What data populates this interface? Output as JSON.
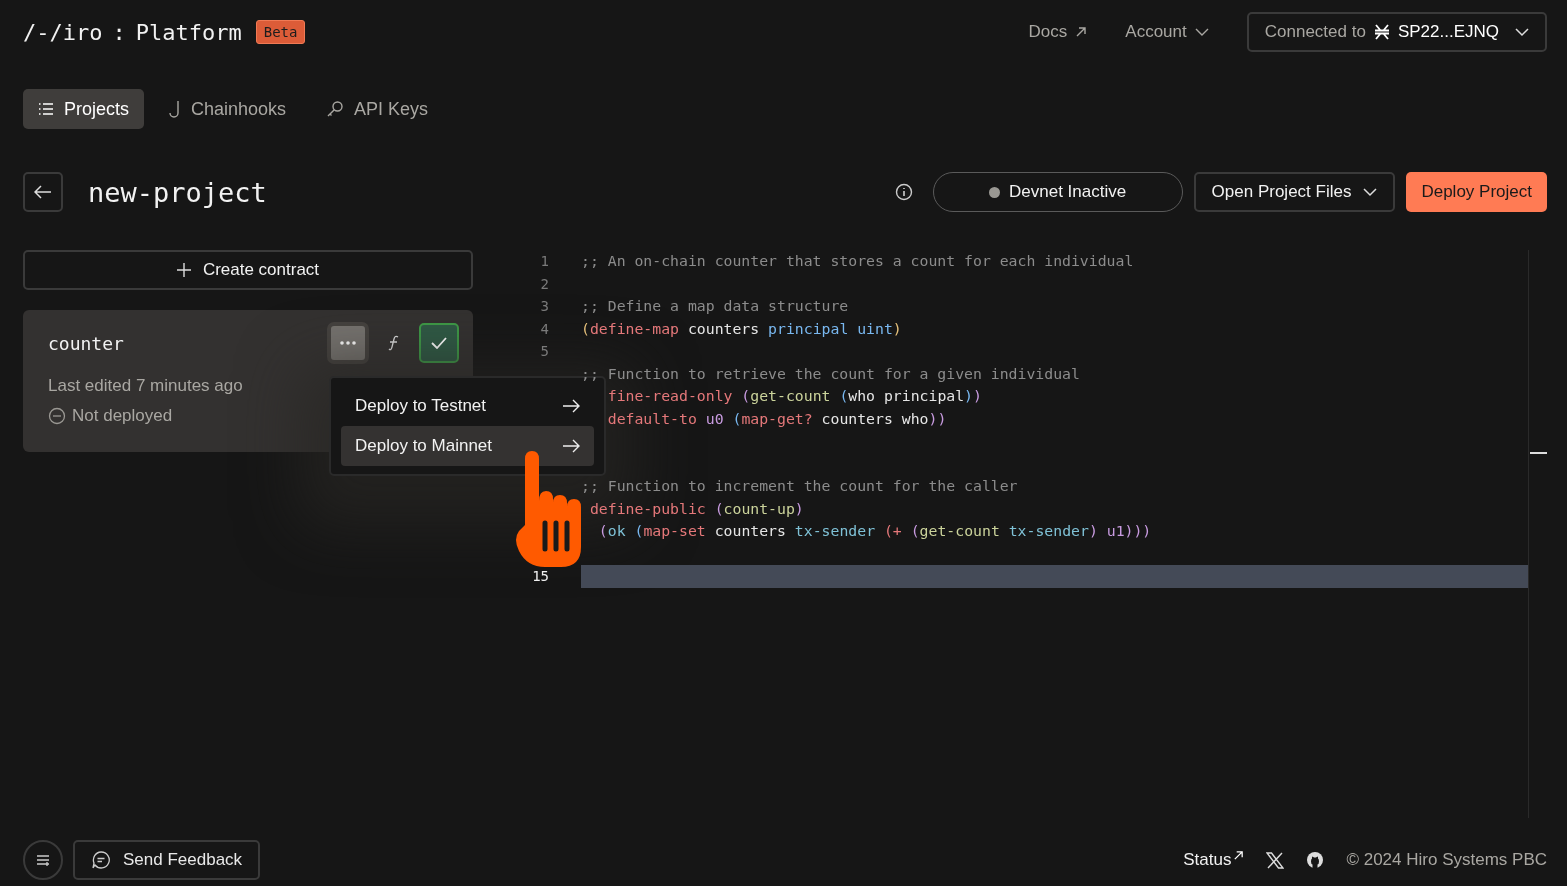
{
  "header": {
    "logo": "/-/iro",
    "separator": ":",
    "product": "Platform",
    "badge": "Beta",
    "links": [
      {
        "label": "Docs",
        "kind": "external"
      },
      {
        "label": "Account",
        "kind": "dropdown"
      }
    ],
    "wallet": {
      "label": "Connected to",
      "address": "SP22...EJNQ"
    }
  },
  "tabs": [
    {
      "label": "Projects",
      "selected": true
    },
    {
      "label": "Chainhooks",
      "selected": false
    },
    {
      "label": "API Keys",
      "selected": false
    }
  ],
  "project": {
    "title": "new-project",
    "devnet": {
      "label": "Devnet Inactive",
      "color": "#9a9893"
    },
    "open_files": "Open Project Files",
    "deploy": "Deploy Project"
  },
  "create_contract": "Create contract",
  "contract": {
    "name": "counter",
    "edited": "Last edited 7 minutes ago",
    "status": "Not deployed",
    "menu": [
      {
        "label": "Deploy to Testnet",
        "selected": false
      },
      {
        "label": "Deploy to Mainnet",
        "selected": true
      }
    ]
  },
  "editor": {
    "lines": [
      {
        "number": "1",
        "active": false,
        "tokens": [
          {
            "text": ";; An on-chain counter that stores a count for each individual",
            "color": "#8c8c8c"
          }
        ]
      },
      {
        "number": "2",
        "active": false
      },
      {
        "number": "3",
        "active": false,
        "tokens": [
          {
            "text": ";; Define a map data structure",
            "color": "#8c8c8c"
          }
        ]
      },
      {
        "number": "4",
        "active": false,
        "tokens": [
          {
            "text": "(",
            "color": "#e5c07b"
          },
          {
            "text": "define-map",
            "color": "#e5787a"
          },
          {
            "text": " counters ",
            "color": "#e6e6e6"
          },
          {
            "text": "principal uint",
            "color": "#79b8f0"
          },
          {
            "text": ")",
            "color": "#e5c07b"
          }
        ]
      },
      {
        "number": "5",
        "active": false
      },
      {
        "active": false,
        "tokens": [
          {
            "text": ";; Function to retrieve the count for a given individual",
            "color": "#8c8c8c"
          }
        ]
      },
      {
        "active": false,
        "tokens": [
          {
            "text": "   fine-read-only ",
            "color": "#e5787a"
          },
          {
            "text": "(",
            "color": "#c89be0"
          },
          {
            "text": "get-count ",
            "color": "#cbd39b"
          },
          {
            "text": "(",
            "color": "#79b8f0"
          },
          {
            "text": "who principal",
            "color": "#e6e6e6"
          },
          {
            "text": ")",
            "color": "#79b8f0"
          },
          {
            "text": ")",
            "color": "#c89be0"
          }
        ]
      },
      {
        "active": false,
        "tokens": [
          {
            "text": "   default-to ",
            "color": "#e5787a"
          },
          {
            "text": "u0 ",
            "color": "#c89be0"
          },
          {
            "text": "(",
            "color": "#79b8f0"
          },
          {
            "text": "map-get? ",
            "color": "#e5787a"
          },
          {
            "text": "counters who",
            "color": "#e6e6e6"
          },
          {
            "text": "))",
            "color": "#c89be0"
          }
        ]
      },
      {
        "active": false
      },
      {
        "active": false
      },
      {
        "active": false,
        "tokens": [
          {
            "text": ";; Function to increment the count for the caller",
            "color": "#8c8c8c"
          }
        ]
      },
      {
        "active": false,
        "tokens": [
          {
            "text": " define-public ",
            "color": "#e5787a"
          },
          {
            "text": "(",
            "color": "#c89be0"
          },
          {
            "text": "count-up",
            "color": "#cbd39b"
          },
          {
            "text": ")",
            "color": "#c89be0"
          }
        ]
      },
      {
        "active": false,
        "tokens": [
          {
            "text": "  (",
            "color": "#c89be0"
          },
          {
            "text": "ok ",
            "color": "#7fc1d6"
          },
          {
            "text": "(",
            "color": "#79b8f0"
          },
          {
            "text": "map-set ",
            "color": "#e5787a"
          },
          {
            "text": "counters ",
            "color": "#e6e6e6"
          },
          {
            "text": "tx-sender ",
            "color": "#7fc1d6"
          },
          {
            "text": "(+ ",
            "color": "#e5787a"
          },
          {
            "text": "(",
            "color": "#c89be0"
          },
          {
            "text": "get-count ",
            "color": "#cbd39b"
          },
          {
            "text": "tx-sender",
            "color": "#7fc1d6"
          },
          {
            "text": ") ",
            "color": "#c89be0"
          },
          {
            "text": "u1",
            "color": "#c89be0"
          },
          {
            "text": ")))",
            "color": "#c89be0"
          }
        ]
      },
      {
        "active": false
      },
      {
        "number": "15",
        "active": true
      }
    ]
  },
  "footer": {
    "feedback": "Send Feedback",
    "status": "Status",
    "copyright": "© 2024 Hiro Systems PBC"
  }
}
